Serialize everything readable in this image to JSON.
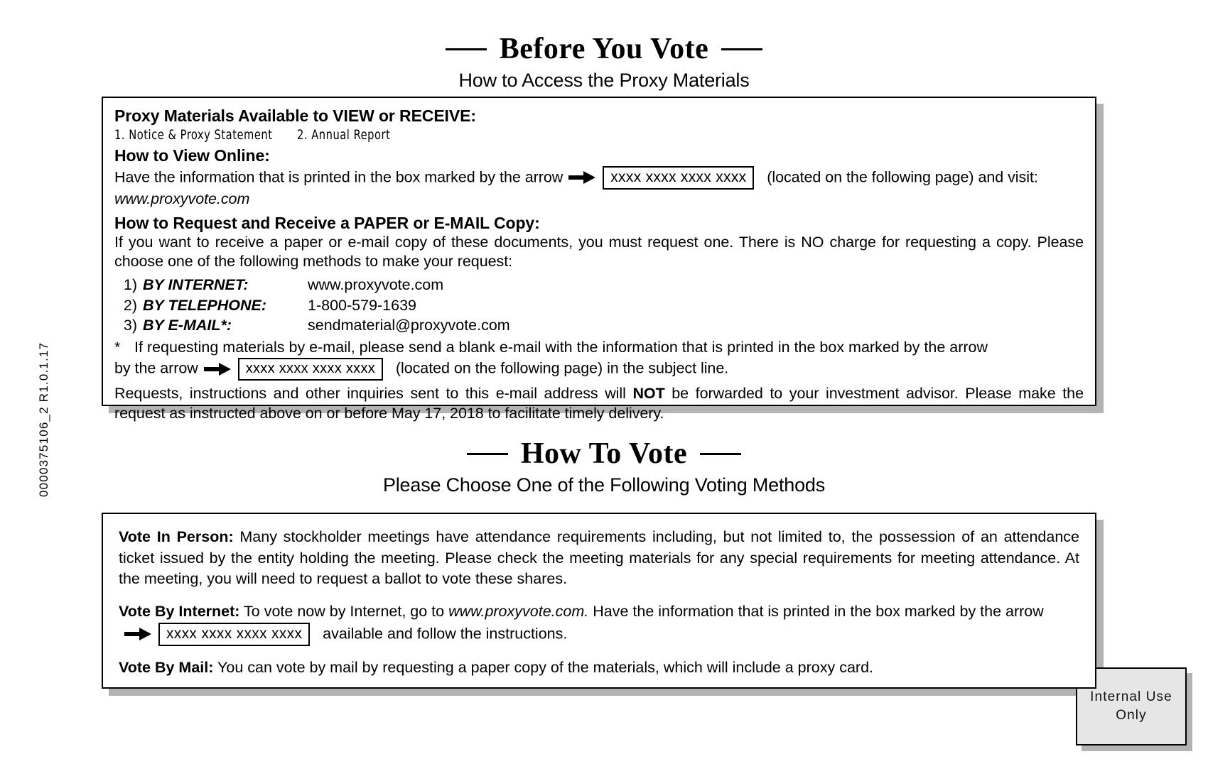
{
  "before_you_vote": {
    "title": "Before You Vote",
    "subtitle": "How to Access the Proxy Materials",
    "materials_heading": "Proxy Materials Available to VIEW or RECEIVE:",
    "materials": [
      "1. Notice & Proxy Statement",
      "2. Annual Report"
    ],
    "view_online_heading": "How to View Online:",
    "view_online_text_1": "Have the information that is printed in the box marked by the arrow",
    "control_number": "xxxx xxxx xxxx xxxx",
    "view_online_text_2": "(located on the following page) and visit:",
    "view_online_url": "www.proxyvote.com",
    "request_heading": "How to Request and Receive a PAPER or E-MAIL Copy:",
    "request_text": "If you want to receive a paper or e-mail copy of these documents, you must request one.  There is NO charge for requesting a copy.  Please choose one of the following methods to make your request:",
    "methods": [
      {
        "num": "1)",
        "label": "BY INTERNET:",
        "value": "www.proxyvote.com"
      },
      {
        "num": "2)",
        "label": "BY TELEPHONE:",
        "value": "1-800-579-1639"
      },
      {
        "num": "3)",
        "label": "BY E-MAIL*:",
        "value": "sendmaterial@proxyvote.com"
      }
    ],
    "footnote_star": "*",
    "footnote_text_1": "If requesting materials by e-mail, please send a blank e-mail with the information that is printed in the box marked by the arrow",
    "footnote_text_2": "(located on the following page) in the subject line.",
    "closing_text_1": "Requests, instructions and other inquiries sent to this e-mail address will",
    "closing_not": "NOT",
    "closing_text_2": "be forwarded to your investment advisor. Please make the request as instructed above on or before",
    "closing_date": "May 17, 2018",
    "closing_text_3": "to facilitate timely delivery."
  },
  "how_to_vote": {
    "title": "How To Vote",
    "subtitle": "Please Choose One of the Following Voting Methods",
    "in_person_label": "Vote In Person:",
    "in_person_text": "Many stockholder meetings have attendance requirements including, but not limited to, the possession of an attendance ticket issued by the entity holding the meeting.  Please check the meeting materials for any special requirements for meeting attendance.  At the meeting, you will need to request a ballot to vote these shares.",
    "internet_label": "Vote By Internet:",
    "internet_text_1": "To vote now by Internet, go to",
    "internet_url": "www.proxyvote.com.",
    "internet_text_2": "Have the information that is printed in the box marked by the arrow",
    "control_number": "xxxx xxxx xxxx xxxx",
    "internet_text_3": "available and follow the instructions.",
    "mail_label": "Vote By Mail:",
    "mail_text": "You can vote by mail by requesting a paper copy of the materials, which will include a proxy card."
  },
  "internal_use": {
    "line1": "Internal Use",
    "line2": "Only"
  },
  "side_code": "0000375106_2    R1.0.1.17",
  "colors": {
    "ink": "#000000",
    "shadow": "#b3b3b3",
    "internal_fill": "#e6e6e6"
  }
}
